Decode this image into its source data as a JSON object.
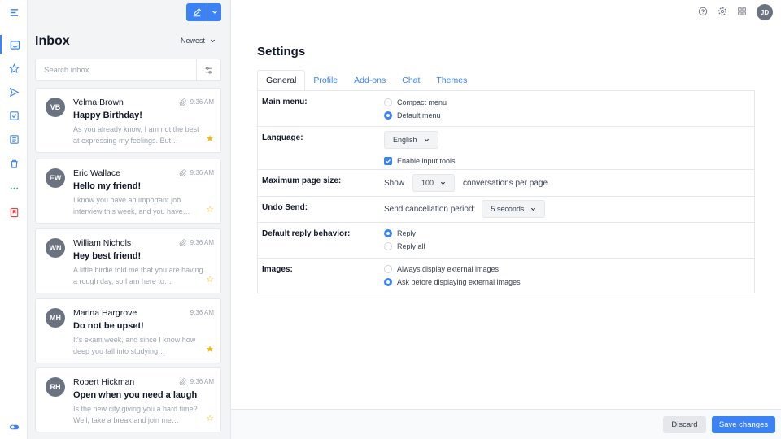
{
  "rail": {
    "items": [
      "menu-icon",
      "inbox-icon",
      "star-icon",
      "send-icon",
      "drafts-icon",
      "notes-icon",
      "trash-icon",
      "more-icon",
      "bookmark-icon",
      "toggle-icon"
    ]
  },
  "inbox": {
    "title": "Inbox",
    "sort_label": "Newest",
    "search_placeholder": "Search inbox",
    "messages": [
      {
        "initials": "VB",
        "name": "Velma Brown",
        "time": "9:36 AM",
        "subject": "Happy Birthday!",
        "preview": "As you already know, I am not the best at expressing my feelings. But…",
        "starred": true,
        "attachment": true
      },
      {
        "initials": "EW",
        "name": "Eric Wallace",
        "time": "9:36 AM",
        "subject": "Hello my friend!",
        "preview": "I know you have an important job interview this week, and you have…",
        "starred": false,
        "attachment": true
      },
      {
        "initials": "WN",
        "name": "William Nichols",
        "time": "9:36 AM",
        "subject": "Hey best friend!",
        "preview": "A little birdie told me that you are having a rough day, so I am here to…",
        "starred": false,
        "attachment": true
      },
      {
        "initials": "MH",
        "name": "Marina Hargrove",
        "time": "9:36 AM",
        "subject": "Do not be upset!",
        "preview": "It's exam week, and since I know how deep you fall into studying…",
        "starred": true,
        "attachment": false
      },
      {
        "initials": "RH",
        "name": "Robert Hickman",
        "time": "9:36 AM",
        "subject": "Open when you need a laugh",
        "preview": "Is the new city giving you a hard time? Well, take a break and join me…",
        "starred": false,
        "attachment": true
      }
    ]
  },
  "topbar": {
    "avatar_initials": "JD"
  },
  "settings": {
    "title": "Settings",
    "tabs": [
      "General",
      "Profile",
      "Add-ons",
      "Chat",
      "Themes"
    ],
    "main_menu": {
      "label": "Main menu:",
      "options": [
        "Compact menu",
        "Default menu"
      ],
      "selected": 1
    },
    "language": {
      "label": "Language:",
      "value": "English",
      "tools_label": "Enable input tools",
      "tools_checked": true
    },
    "page_size": {
      "label": "Maximum page size:",
      "prefix": "Show",
      "value": "100",
      "suffix": "conversations per page"
    },
    "undo_send": {
      "label": "Undo Send:",
      "prefix": "Send cancellation period:",
      "value": "5 seconds"
    },
    "reply": {
      "label": "Default reply behavior:",
      "options": [
        "Reply",
        "Reply all"
      ],
      "selected": 0
    },
    "images": {
      "label": "Images:",
      "options": [
        "Always display external images",
        "Ask before displaying external images"
      ],
      "selected": 1
    }
  },
  "footer": {
    "discard": "Discard",
    "save": "Save changes"
  },
  "colors": {
    "accent": "#3b82f6",
    "star": "#f5b800"
  }
}
